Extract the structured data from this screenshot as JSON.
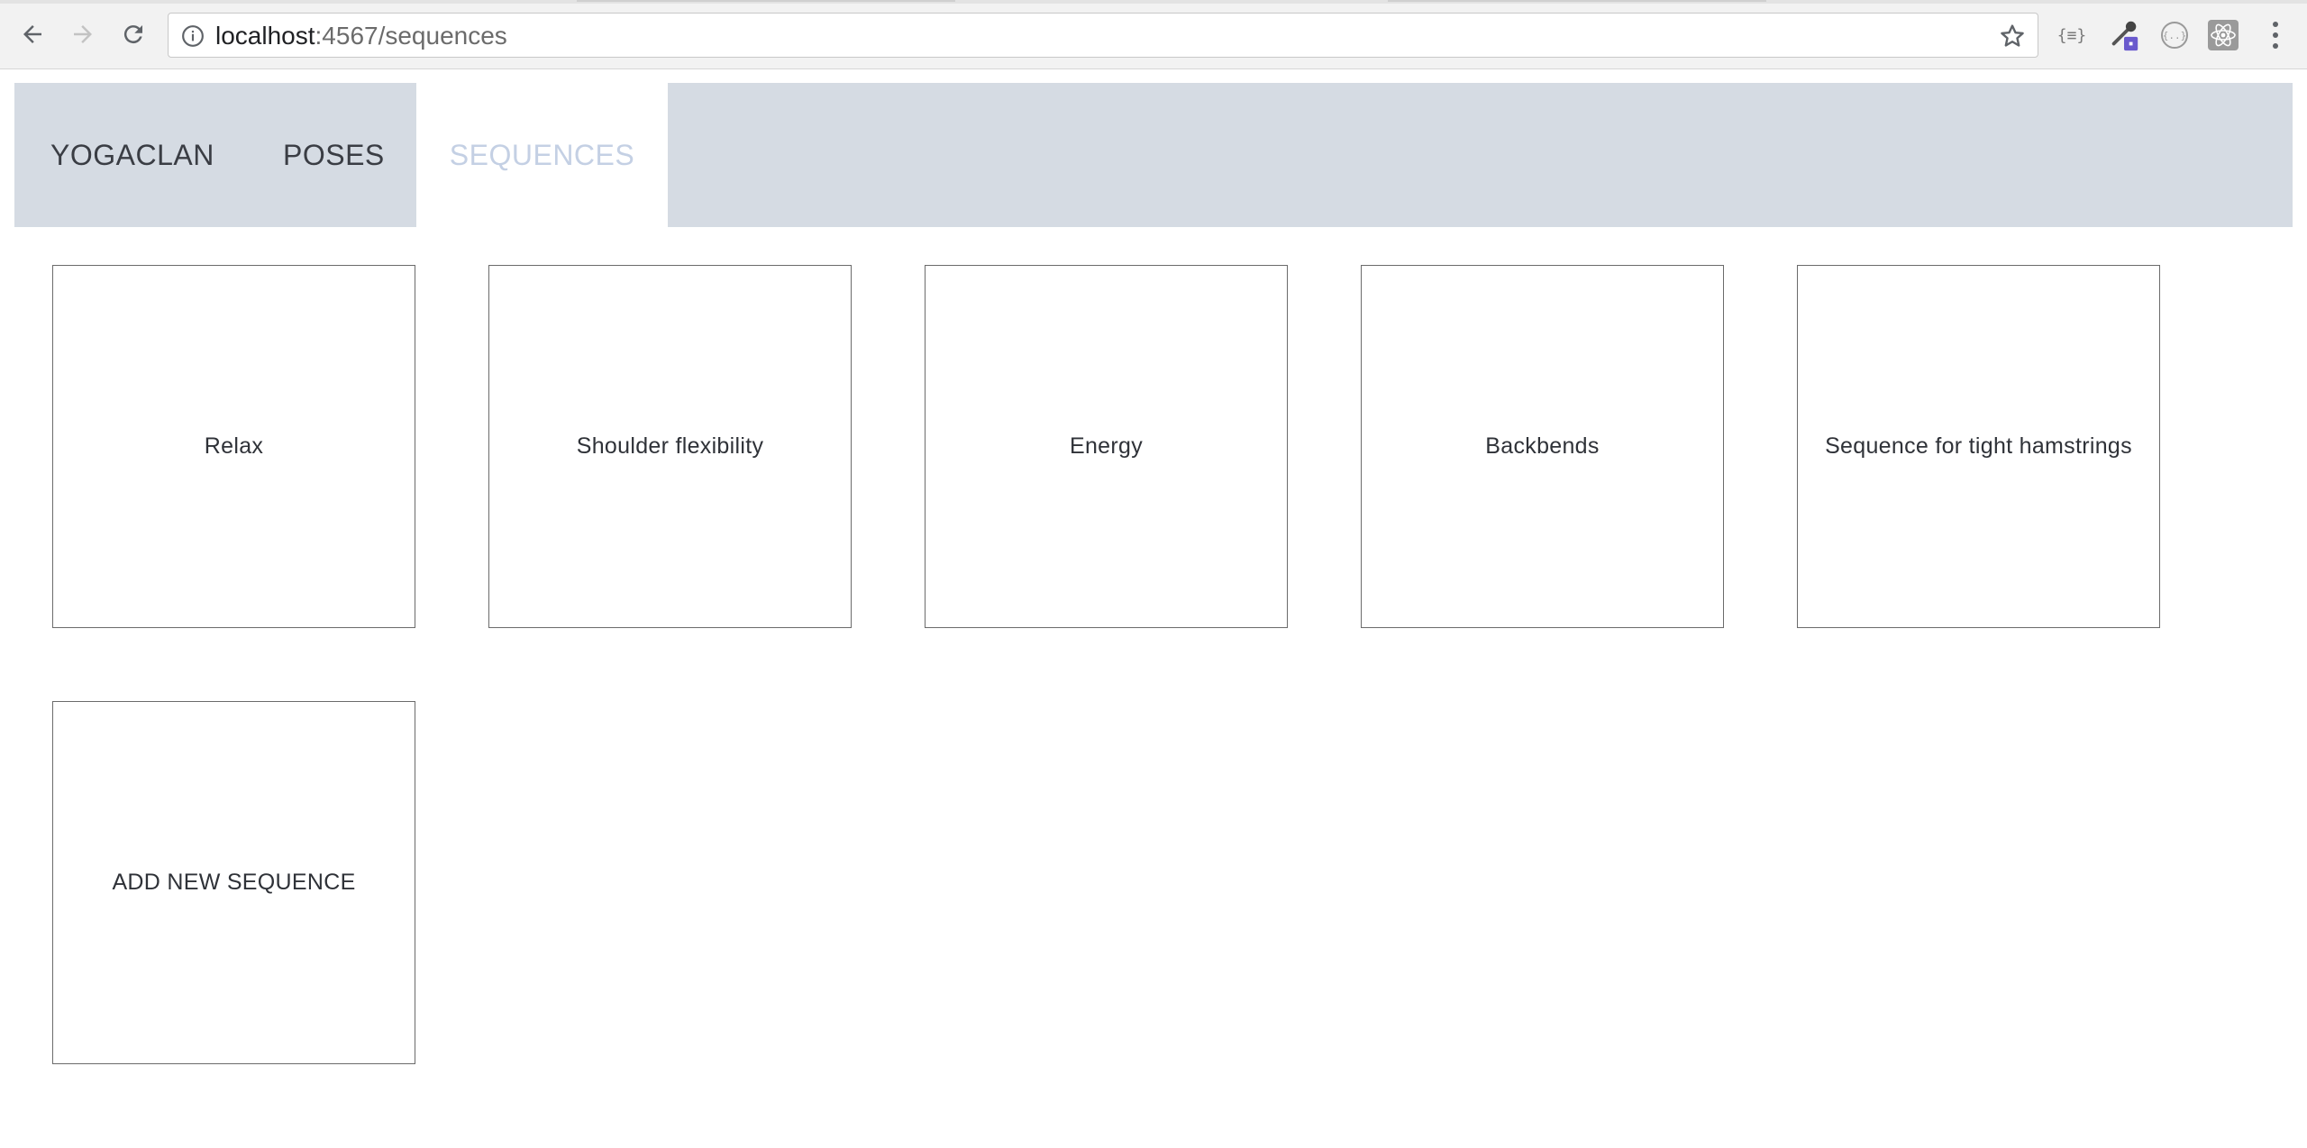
{
  "browser": {
    "url_host": "localhost",
    "url_rest": ":4567/sequences",
    "icons": {
      "back": "arrow-left-icon",
      "forward": "arrow-right-icon",
      "reload": "reload-icon",
      "info": "info-icon",
      "bookmark": "star-icon",
      "extensions": [
        "json-formatter-icon",
        "eyedropper-icon",
        "json-viewer-icon",
        "react-devtools-icon"
      ],
      "menu": "more-vertical-icon"
    },
    "ext_json_label": "{≡}"
  },
  "nav": {
    "brand": "YOGACLAN",
    "items": [
      {
        "label": "POSES",
        "active": false
      },
      {
        "label": "SEQUENCES",
        "active": true
      }
    ],
    "colors": {
      "bar": "#d5dbe3",
      "text": "#3a3d44",
      "active_text": "#c4d0e4"
    }
  },
  "sequences": [
    {
      "name": "Relax"
    },
    {
      "name": "Shoulder flexibility"
    },
    {
      "name": "Energy"
    },
    {
      "name": "Backbends"
    },
    {
      "name": "Sequence for tight hamstrings"
    }
  ],
  "add_button_label": "ADD NEW SEQUENCE"
}
